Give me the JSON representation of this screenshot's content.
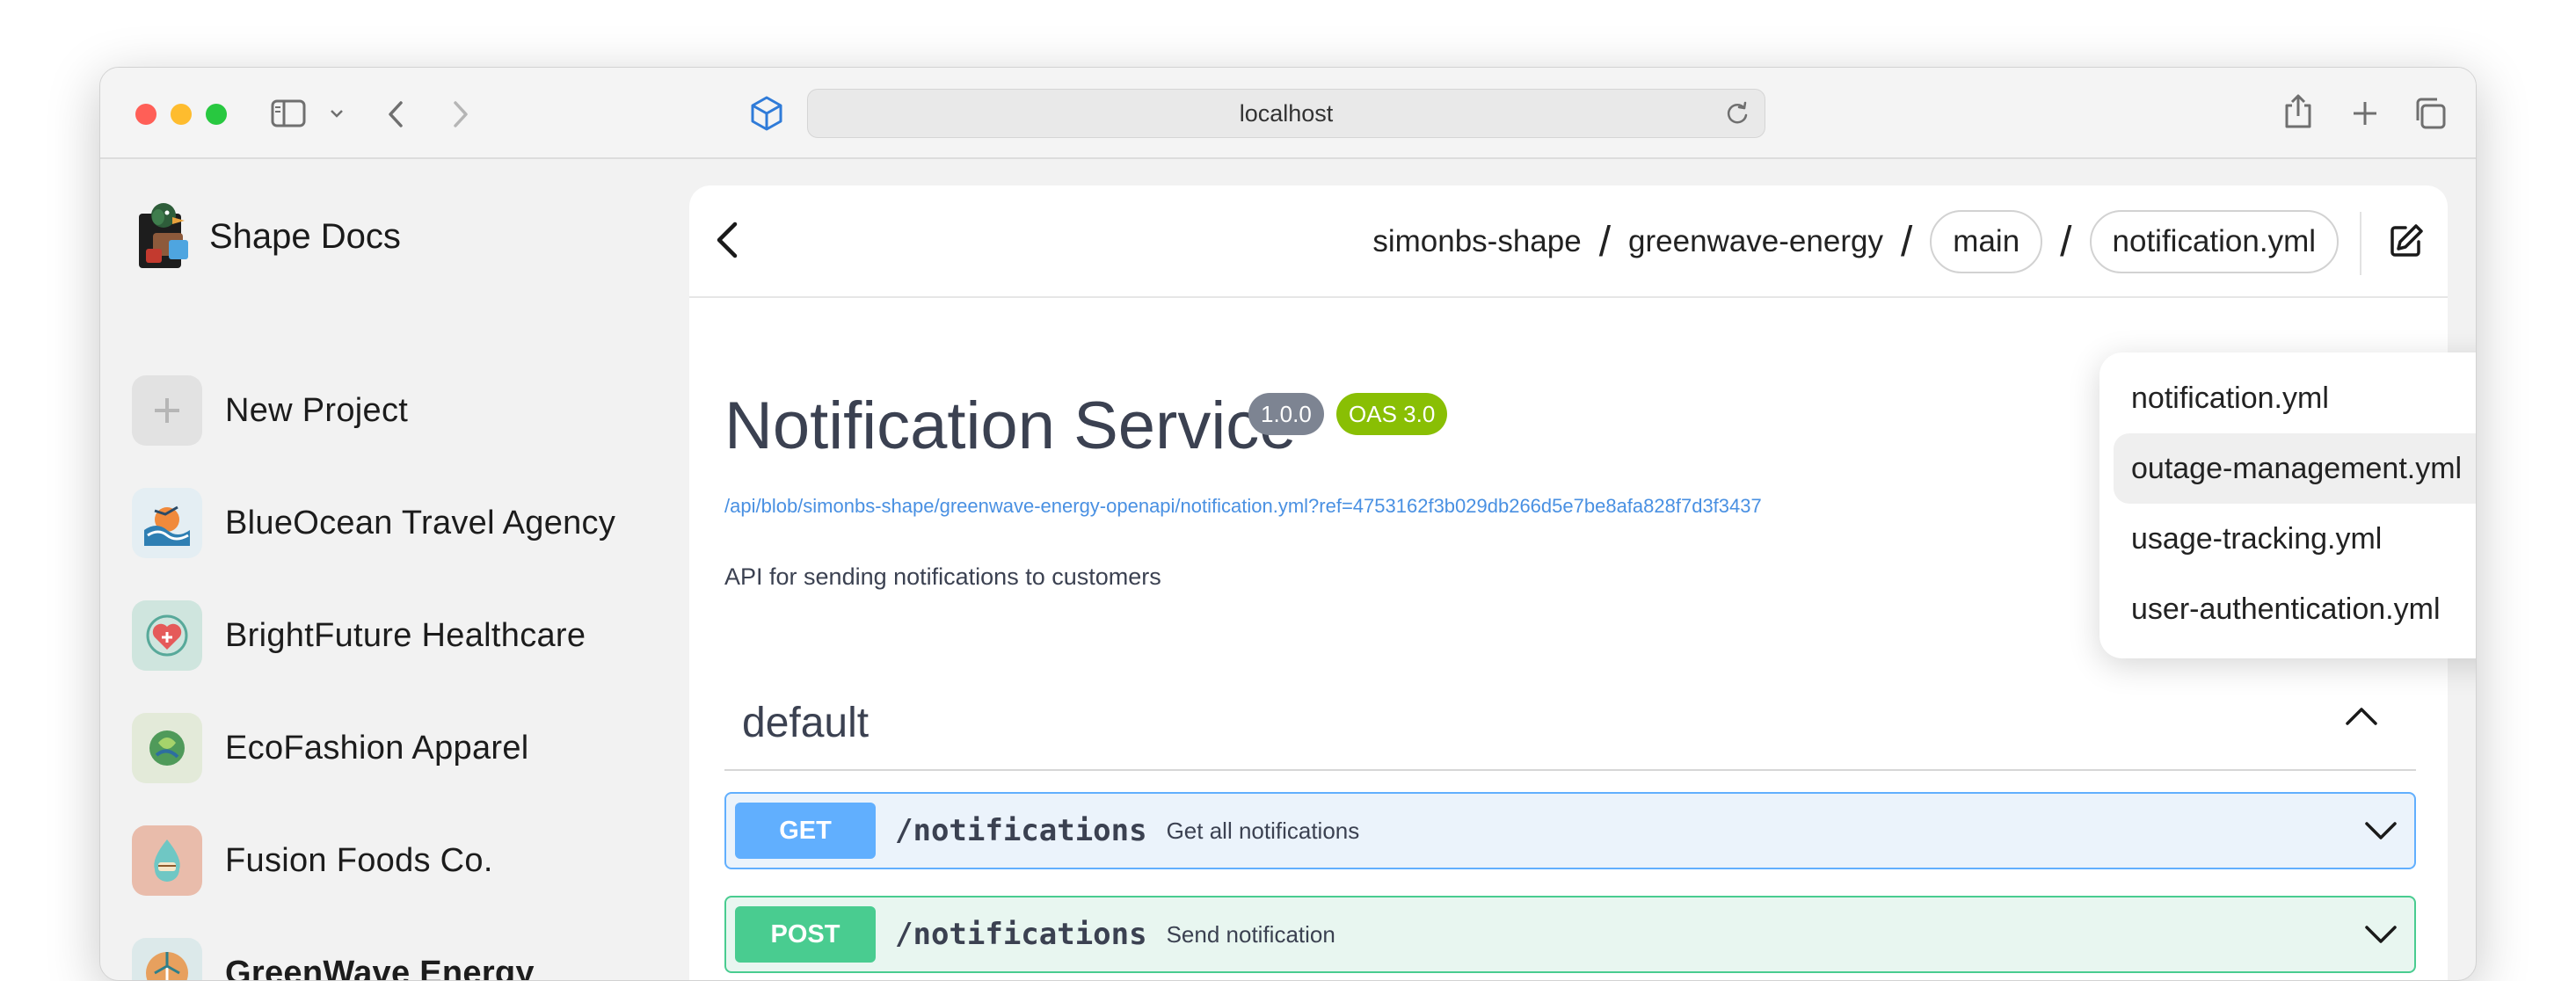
{
  "browser": {
    "url": "localhost"
  },
  "sidebar": {
    "brand_title": "Shape Docs",
    "new_project": "New Project",
    "projects": [
      {
        "name": "BlueOcean Travel Agency",
        "icon_color": "#e4eef3"
      },
      {
        "name": "BrightFuture Healthcare",
        "icon_color": "#cfe5de"
      },
      {
        "name": "EcoFashion Apparel",
        "icon_color": "#e3ead9"
      },
      {
        "name": "Fusion Foods Co.",
        "icon_color": "#e9bcab"
      },
      {
        "name": "GreenWave Energy",
        "icon_color": "#dce9ea",
        "selected": true
      }
    ]
  },
  "header": {
    "breadcrumb_owner": "simonbs-shape",
    "separator": "/",
    "breadcrumb_project": "greenwave-energy",
    "branch": "main",
    "file": "notification.yml"
  },
  "file_menu": {
    "items": [
      "notification.yml",
      "outage-management.yml",
      "usage-tracking.yml",
      "user-authentication.yml"
    ],
    "hovered_index": 1
  },
  "doc": {
    "title": "Notification Service",
    "version": "1.0.0",
    "oas": "OAS 3.0",
    "spec_url": "/api/blob/simonbs-shape/greenwave-energy-openapi/notification.yml?ref=4753162f3b029db266d5e7be8afa828f7d3f3437",
    "description": "API for sending notifications to customers",
    "section": "default",
    "operations": [
      {
        "method": "GET",
        "path": "/notifications",
        "summary": "Get all notifications"
      },
      {
        "method": "POST",
        "path": "/notifications",
        "summary": "Send notification"
      }
    ]
  },
  "colors": {
    "get": "#61affe",
    "post": "#49cc90",
    "version_badge": "#7d8492",
    "oas_badge": "#89bf04",
    "link": "#4990e2"
  }
}
